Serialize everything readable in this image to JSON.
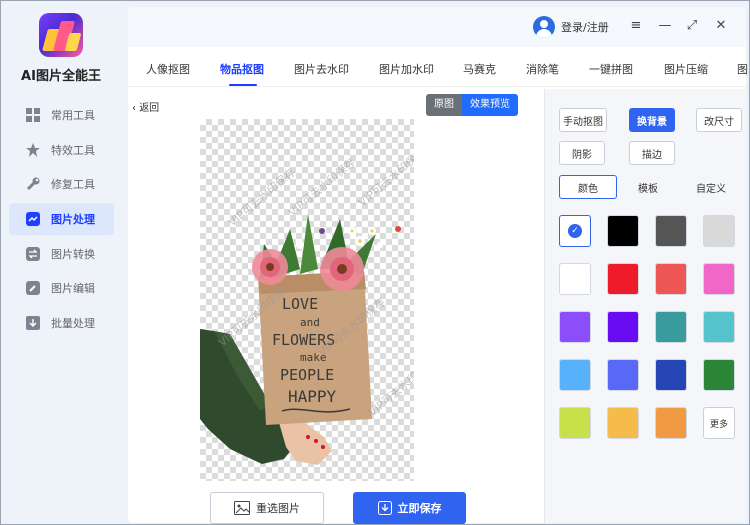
{
  "app": {
    "name": "AI图片全能王"
  },
  "sidebar": {
    "items": [
      {
        "label": "常用工具",
        "icon": "grid-icon",
        "active": false
      },
      {
        "label": "特效工具",
        "icon": "star-icon",
        "active": false
      },
      {
        "label": "修复工具",
        "icon": "wrench-icon",
        "active": false
      },
      {
        "label": "图片处理",
        "icon": "image-process-icon",
        "active": true
      },
      {
        "label": "图片转换",
        "icon": "convert-icon",
        "active": false
      },
      {
        "label": "图片编辑",
        "icon": "edit-icon",
        "active": false
      },
      {
        "label": "批量处理",
        "icon": "batch-icon",
        "active": false
      }
    ]
  },
  "header": {
    "login_label": "登录/注册",
    "menu_icon": "≡",
    "min_icon": "—",
    "max_icon": "⤢",
    "close_icon": "✕"
  },
  "tabs": [
    {
      "label": "人像抠图",
      "active": false
    },
    {
      "label": "物品抠图",
      "active": true
    },
    {
      "label": "图片去水印",
      "active": false
    },
    {
      "label": "图片加水印",
      "active": false
    },
    {
      "label": "马赛克",
      "active": false
    },
    {
      "label": "消除笔",
      "active": false
    },
    {
      "label": "一键拼图",
      "active": false
    },
    {
      "label": "图片压缩",
      "active": false
    },
    {
      "label": "图",
      "active": false
    }
  ],
  "canvas": {
    "back_label": "返回",
    "toggle_original": "原图",
    "toggle_preview": "效果预览",
    "watermark_text": "VIP可去水印保存",
    "bag_text": [
      "LOVE",
      "and",
      "FLOWERS",
      "make",
      "PEOPLE",
      "HAPPY"
    ]
  },
  "actions": {
    "reselect_label": "重选图片",
    "save_label": "立即保存"
  },
  "panel": {
    "buttons": [
      "手动抠图",
      "换背景",
      "改尺寸",
      "阴影",
      "描边"
    ],
    "active_button": "换背景",
    "subtabs": [
      "颜色",
      "模板",
      "自定义"
    ],
    "active_subtab": "颜色",
    "more_label": "更多",
    "swatches": [
      "selected",
      "#000000",
      "#555555",
      "#d9d9d9",
      "#ffffff",
      "#ee1c2b",
      "#ef5656",
      "#f266c7",
      "#8c4dfb",
      "#6a0cf3",
      "#3a9b9f",
      "#54c3cc",
      "#57b2fb",
      "#5a68f8",
      "#2445b3",
      "#2a8536",
      "#c8e04a",
      "#f5bb4b",
      "#f19a44"
    ]
  }
}
